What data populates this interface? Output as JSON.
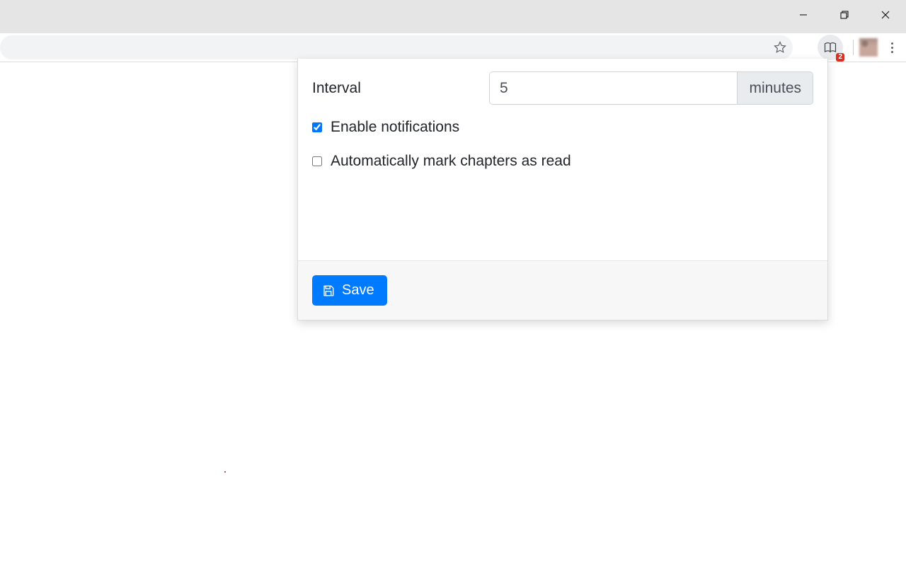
{
  "window": {
    "extension_badge": "2"
  },
  "popup": {
    "interval_label": "Interval",
    "interval_value": "5",
    "interval_unit": "minutes",
    "enable_notifications_label": "Enable notifications",
    "enable_notifications_checked": true,
    "auto_mark_label": "Automatically mark chapters as read",
    "auto_mark_checked": false,
    "save_label": "Save"
  }
}
